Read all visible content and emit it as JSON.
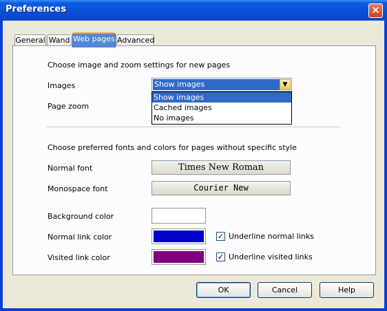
{
  "window": {
    "title": "Preferences"
  },
  "tabs": [
    {
      "label": "General"
    },
    {
      "label": "Wand"
    },
    {
      "label": "Web pages"
    },
    {
      "label": "Advanced"
    }
  ],
  "active_tab": "Web pages",
  "zoom_section": {
    "heading": "Choose image and zoom settings for new pages",
    "images_label": "Images",
    "images_value": "Show images",
    "images_options": [
      "Show images",
      "Cached images",
      "No images"
    ],
    "page_zoom_label": "Page zoom"
  },
  "fonts_section": {
    "heading": "Choose preferred fonts and colors for pages without specific style",
    "normal_font_label": "Normal font",
    "normal_font_value": "Times New Roman",
    "mono_font_label": "Monospace font",
    "mono_font_value": "Courier New",
    "bg_color_label": "Background color",
    "bg_color": "#ffffff",
    "normal_link_label": "Normal link color",
    "normal_link_color": "#0000cc",
    "underline_normal_label": "Underline normal links",
    "underline_normal_checked": true,
    "visited_link_label": "Visited link color",
    "visited_link_color": "#800080",
    "underline_visited_label": "Underline visited links",
    "underline_visited_checked": true
  },
  "buttons": {
    "ok": "OK",
    "cancel": "Cancel",
    "help": "Help"
  }
}
